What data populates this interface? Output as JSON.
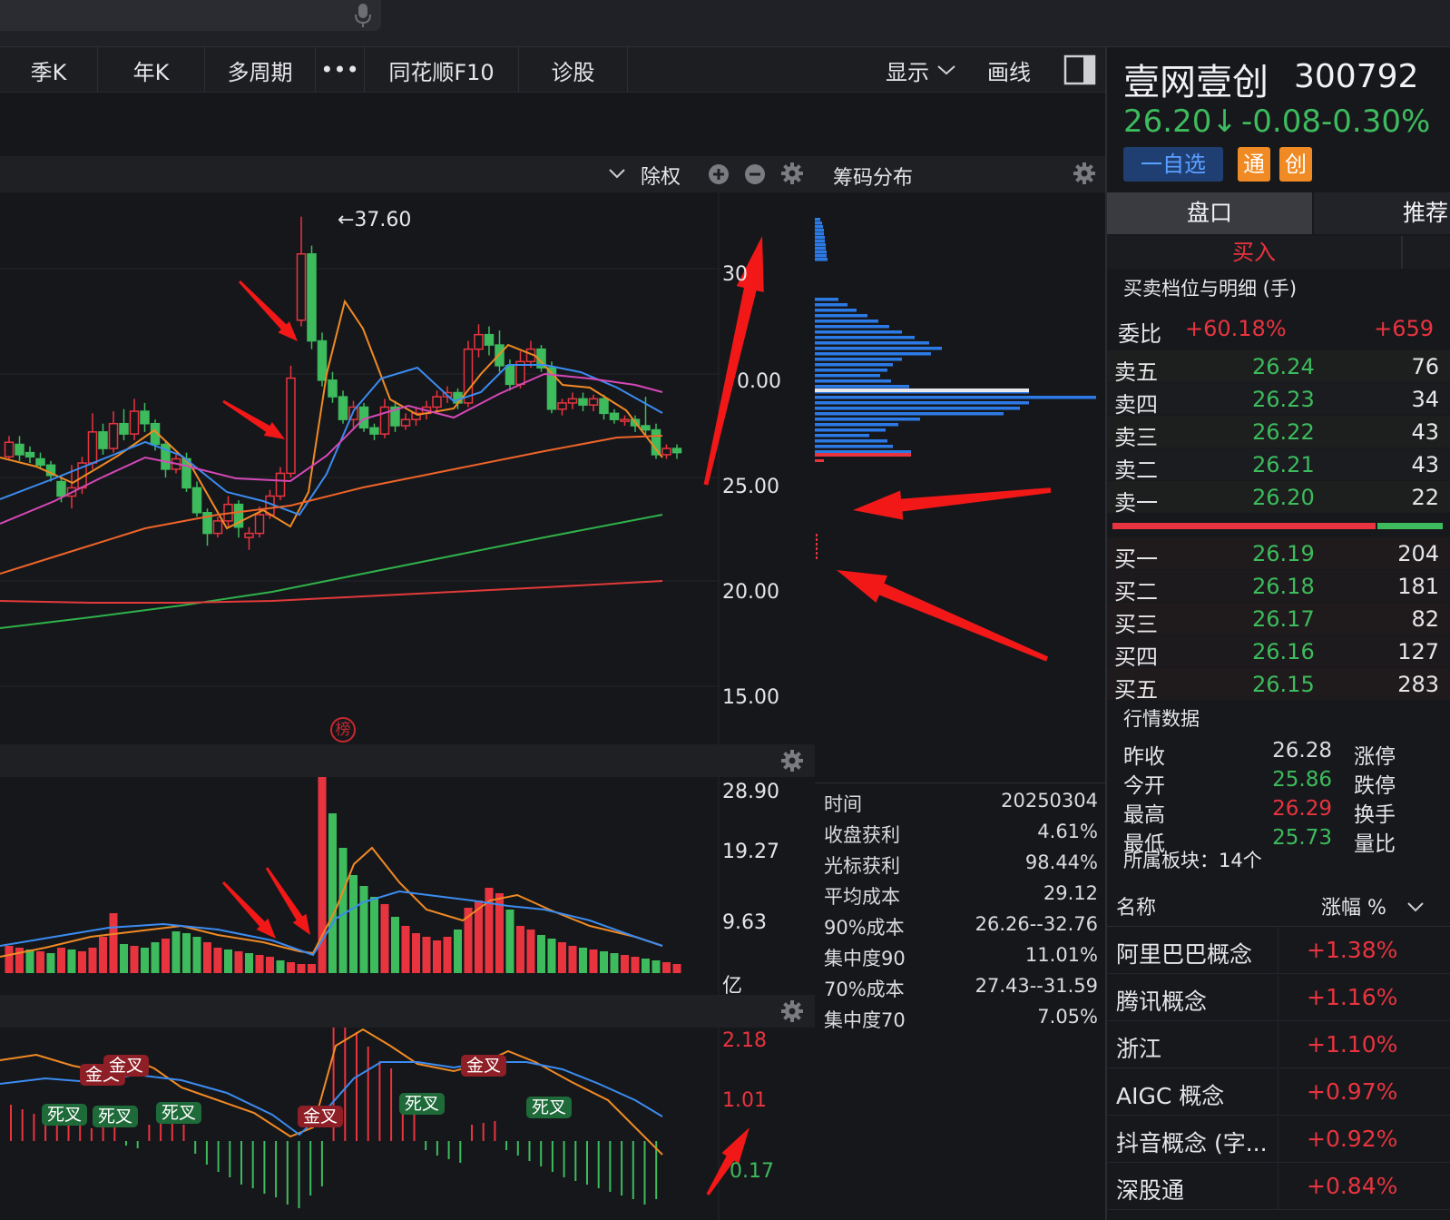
{
  "toolbar": {
    "tabs": [
      "季K",
      "年K",
      "多周期",
      "•••",
      "同花顺F10",
      "诊股"
    ],
    "display": "显示",
    "draw": "画线"
  },
  "chart_header": {
    "adjust": "除权"
  },
  "chip_header": {
    "title": "筹码分布"
  },
  "price_axis": [
    "30",
    "0.00",
    "25.00",
    "20.00",
    "15.00"
  ],
  "peak_label": "←37.60",
  "bang_badge": "榜",
  "volume_axis": [
    "28.90",
    "19.27",
    "9.63",
    "亿"
  ],
  "macd_axis": [
    "2.18",
    "1.01",
    "0.17"
  ],
  "crosses": [
    {
      "text": "金叉",
      "type": "gold"
    },
    {
      "text": "金叉",
      "type": "gold"
    },
    {
      "text": "死叉",
      "type": "dead"
    },
    {
      "text": "死叉",
      "type": "dead"
    },
    {
      "text": "死叉",
      "type": "dead"
    },
    {
      "text": "金叉",
      "type": "gold"
    },
    {
      "text": "死叉",
      "type": "dead"
    },
    {
      "text": "金叉",
      "type": "gold"
    },
    {
      "text": "死叉",
      "type": "dead"
    }
  ],
  "chip_stats": [
    {
      "label": "时间",
      "value": "20250304"
    },
    {
      "label": "收盘获利",
      "value": "4.61%"
    },
    {
      "label": "光标获利",
      "value": "98.44%"
    },
    {
      "label": "平均成本",
      "value": "29.12"
    },
    {
      "label": "90%成本",
      "value": "26.26--32.76"
    },
    {
      "label": "集中度90",
      "value": "11.01%"
    },
    {
      "label": "70%成本",
      "value": "27.43--31.59"
    },
    {
      "label": "集中度70",
      "value": "7.05%"
    }
  ],
  "stock": {
    "name": "壹网壹创",
    "code": "300792",
    "price": "26.20↓",
    "change": "-0.08",
    "change_pct": "-0.30%",
    "watch": "一自选",
    "tag1": "通",
    "tag2": "创"
  },
  "panel_tabs": [
    "盘口",
    "推荐"
  ],
  "buy_tab": "买入",
  "orderbook_title": "买卖档位与明细 (手)",
  "weibi": {
    "label": "委比",
    "pct": "+60.18%",
    "diff": "+659"
  },
  "asks": [
    {
      "label": "卖五",
      "price": "26.24",
      "vol": "76"
    },
    {
      "label": "卖四",
      "price": "26.23",
      "vol": "34"
    },
    {
      "label": "卖三",
      "price": "26.22",
      "vol": "43"
    },
    {
      "label": "卖二",
      "price": "26.21",
      "vol": "43"
    },
    {
      "label": "卖一",
      "price": "26.20",
      "vol": "22"
    }
  ],
  "bids": [
    {
      "label": "买一",
      "price": "26.19",
      "vol": "204"
    },
    {
      "label": "买二",
      "price": "26.18",
      "vol": "181"
    },
    {
      "label": "买三",
      "price": "26.17",
      "vol": "82"
    },
    {
      "label": "买四",
      "price": "26.16",
      "vol": "127"
    },
    {
      "label": "买五",
      "price": "26.15",
      "vol": "283"
    }
  ],
  "quote_title": "行情数据",
  "quotes": [
    {
      "label": "昨收",
      "value": "26.28",
      "color": "#dcdce0",
      "right": "涨停"
    },
    {
      "label": "今开",
      "value": "25.86",
      "color": "#3dbb5d",
      "right": "跌停"
    },
    {
      "label": "最高",
      "value": "26.29",
      "color": "#e8343f",
      "right": "换手"
    },
    {
      "label": "最低",
      "value": "25.73",
      "color": "#3dbb5d",
      "right": "量比"
    }
  ],
  "board_title": "所属板块：14个",
  "board_head": {
    "name": "名称",
    "chg": "涨幅 %"
  },
  "boards": [
    {
      "name": "阿里巴巴概念",
      "chg": "+1.38%"
    },
    {
      "name": "腾讯概念",
      "chg": "+1.16%"
    },
    {
      "name": "浙江",
      "chg": "+1.10%"
    },
    {
      "name": "AIGC 概念",
      "chg": "+0.97%"
    },
    {
      "name": "抖音概念 (字...",
      "chg": "+0.92%"
    },
    {
      "name": "深股通",
      "chg": "+0.84%"
    }
  ],
  "colors": {
    "up": "#e8343f",
    "down": "#3dbb5d",
    "accent": "#f08a24",
    "ma_blue": "#3b8cf0",
    "ma_pink": "#d648b8"
  }
}
